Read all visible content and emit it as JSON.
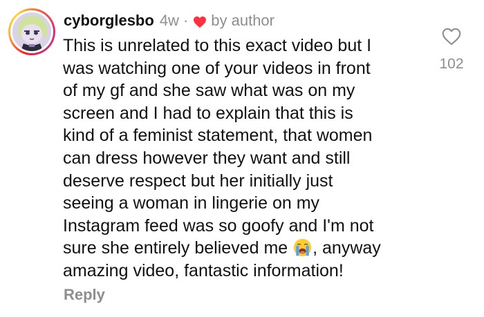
{
  "comment": {
    "username": "cyborglesbo",
    "age": "4w",
    "separator": "·",
    "liked_by_author_label": "by author",
    "text_lines": [
      "This is unrelated to this exact video but I",
      "was watching one of your videos in front",
      "of my gf and she saw what was on my",
      "screen and I had to explain that this is",
      "kind of a feminist statement, that women",
      "can dress however they want and still",
      "deserve respect but her initially just",
      "seeing a woman in lingerie on my",
      "Instagram feed was so goofy and I'm not"
    ],
    "line_before_emoji": "sure she entirely believed me",
    "line_after_emoji": ", anyway",
    "last_line": "amazing video, fantastic information!",
    "emoji_icon": "loudly-crying-face-emoji",
    "reply_label": "Reply",
    "like_count": "102"
  },
  "colors": {
    "author_heart": "#ff3040",
    "muted_text": "#8e8e8e",
    "primary_text": "#111111"
  }
}
